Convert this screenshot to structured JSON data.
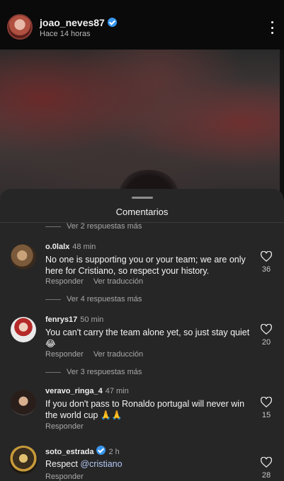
{
  "post": {
    "username": "joao_neves87",
    "timestamp": "Hace 14 horas"
  },
  "sheet": {
    "title": "Comentarios",
    "top_view_replies": "Ver 2 respuestas más"
  },
  "comments": [
    {
      "username": "o.0lalx",
      "time": "48 min",
      "text": "No one is supporting you or your team; we are only here for Cristiano, so respect your history.",
      "reply": "Responder",
      "translate": "Ver traducción",
      "likes": "36",
      "view_replies": "Ver 4 respuestas más"
    },
    {
      "username": "fenrys17",
      "time": "50 min",
      "text": "You can't carry the team alone yet, so just stay quiet 😂",
      "reply": "Responder",
      "translate": "Ver traducción",
      "likes": "20",
      "view_replies": "Ver 3 respuestas más"
    },
    {
      "username": "veravo_ringa_4",
      "time": "47 min",
      "text": "If you don't pass to Ronaldo portugal will never win the world cup 🙏🙏",
      "reply": "Responder",
      "likes": "15"
    },
    {
      "username": "soto_estrada",
      "time": "2 h",
      "text_prefix": "Respect ",
      "mention": "@cristiano",
      "reply": "Responder",
      "likes": "28"
    }
  ],
  "colors": {
    "sheet_bg": "#262626",
    "verified": "#3897f0",
    "mention": "#b3c7f5"
  }
}
